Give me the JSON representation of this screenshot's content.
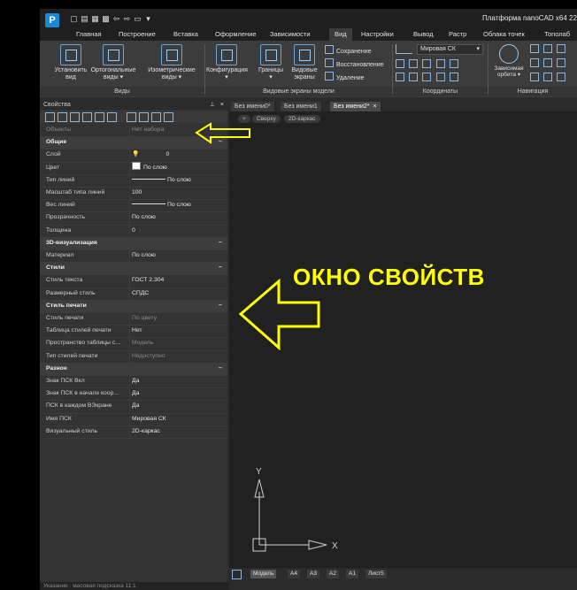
{
  "app": {
    "logo_letter": "P",
    "title": "Платформа nanoCAD x64 22",
    "quick_access": [
      "new-file-icon",
      "open-file-icon",
      "save-icon",
      "save-all-icon",
      "print-icon",
      "undo-icon",
      "redo-icon",
      "more-icon"
    ]
  },
  "menu": {
    "tabs": [
      {
        "label": "Главная"
      },
      {
        "label": "Построение"
      },
      {
        "label": "Вставка"
      },
      {
        "label": "Оформление"
      },
      {
        "label": "Зависимости"
      },
      {
        "label": "Вид"
      },
      {
        "label": "Настройки"
      },
      {
        "label": "Вывод"
      },
      {
        "label": "Растр"
      },
      {
        "label": "Облака точек"
      },
      {
        "label": "Тополаб"
      }
    ],
    "active": "Вид"
  },
  "ribbon": {
    "views": {
      "panel_label": "Виды",
      "buttons": [
        {
          "label": "Установить\nвид"
        },
        {
          "label": "Ортогональные\nвиды ▾"
        },
        {
          "label": "Изометрические\nвиды ▾"
        }
      ]
    },
    "viewports": {
      "panel_label": "Видовые экраны модели",
      "buttons": [
        {
          "label": "Конфигурация\n▾"
        },
        {
          "label": "Границы\n▾"
        },
        {
          "label": "Видовые\nэкраны"
        }
      ],
      "small": [
        {
          "label": "Сохранение"
        },
        {
          "label": "Восстановление"
        },
        {
          "label": "Удаление"
        }
      ]
    },
    "coords": {
      "panel_label": "Координаты",
      "ucs_value": "Мировая СК"
    },
    "nav": {
      "panel_label": "Навигация",
      "orbit_label": "Зависимая\nорбита ▾"
    }
  },
  "properties": {
    "title": "Свойства",
    "header_controls": [
      "pin-icon",
      "close-icon"
    ],
    "rows": [
      {
        "type": "row",
        "key": "Объекты",
        "value": "Нет набора",
        "dim": true
      },
      {
        "type": "section",
        "key": "Общие"
      },
      {
        "type": "row",
        "key": "Слой",
        "value": "0",
        "layer": true
      },
      {
        "type": "row",
        "key": "Цвет",
        "value": "По слою",
        "swatch": true
      },
      {
        "type": "row",
        "key": "Тип линий",
        "value": "По слою",
        "line": true
      },
      {
        "type": "row",
        "key": "Масштаб типа линий",
        "value": "100"
      },
      {
        "type": "row",
        "key": "Вес линий",
        "value": "По слою",
        "line": true
      },
      {
        "type": "row",
        "key": "Прозрачность",
        "value": "По слою"
      },
      {
        "type": "row",
        "key": "Толщина",
        "value": "0"
      },
      {
        "type": "section",
        "key": "3D-визуализация"
      },
      {
        "type": "row",
        "key": "Материал",
        "value": "По слою"
      },
      {
        "type": "section",
        "key": "Стили"
      },
      {
        "type": "row",
        "key": "Стиль текста",
        "value": "ГОСТ 2.304"
      },
      {
        "type": "row",
        "key": "Размерный стиль",
        "value": "СПДС"
      },
      {
        "type": "section",
        "key": "Стиль печати"
      },
      {
        "type": "row",
        "key": "Стиль печати",
        "value": "По цвету",
        "dim": true
      },
      {
        "type": "row",
        "key": "Таблица стилей печати",
        "value": "Нет"
      },
      {
        "type": "row",
        "key": "Пространство таблицы с...",
        "value": "Модель",
        "dim": true
      },
      {
        "type": "row",
        "key": "Тип стилей печати",
        "value": "Недоступно",
        "dim": true
      },
      {
        "type": "section",
        "key": "Разное"
      },
      {
        "type": "row",
        "key": "Знак ПСК Вкл",
        "value": "Да"
      },
      {
        "type": "row",
        "key": "Знак ПСК в начале коор...",
        "value": "Да"
      },
      {
        "type": "row",
        "key": "ПСК в каждом ВЭкране",
        "value": "Да"
      },
      {
        "type": "row",
        "key": "Имя ПСК",
        "value": "Мировая СК"
      },
      {
        "type": "row",
        "key": "Визуальный стиль",
        "value": "2D-каркас"
      }
    ]
  },
  "documents": {
    "tabs": [
      {
        "label": "Без имени0*"
      },
      {
        "label": "Без имени1"
      },
      {
        "label": "Без имени2*",
        "active": true
      }
    ],
    "view_pills": [
      "+",
      "Сверху",
      "2D-каркас"
    ]
  },
  "layouts": {
    "tabs": [
      "Модель",
      "A4",
      "A3",
      "A2",
      "A1",
      "Лист5"
    ],
    "active": "Модель"
  },
  "ucs": {
    "y_label": "Y",
    "x_label": "X"
  },
  "status_text": "Указание : масовая подсказка 11:1",
  "annotation": {
    "text": "ОКНО СВОЙСТВ",
    "color": "#ffff00"
  }
}
